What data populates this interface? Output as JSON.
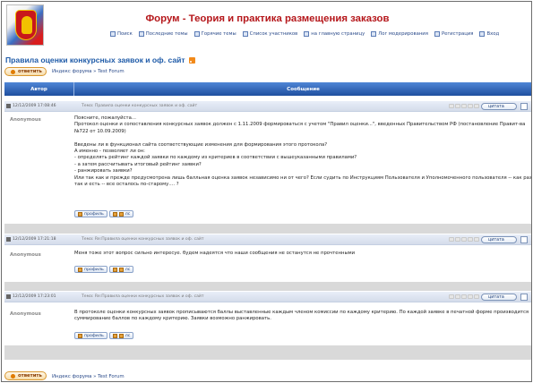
{
  "header": {
    "title": "Форум - Теория и практика размещения заказов",
    "nav": [
      {
        "label": "Поиск",
        "icon": "search-icon"
      },
      {
        "label": "Последние темы",
        "icon": "topics-icon"
      },
      {
        "label": "Горячие темы",
        "icon": "hot-topics-icon"
      },
      {
        "label": "Список участников",
        "icon": "members-icon"
      },
      {
        "label": "на главную страницу",
        "icon": "home-icon"
      },
      {
        "label": "Лог модерирования",
        "icon": "moderation-log-icon"
      },
      {
        "label": "Регистрация",
        "icon": "register-icon"
      },
      {
        "label": "Вход",
        "icon": "login-icon"
      }
    ]
  },
  "topic": {
    "title": "Правила оценки конкурсных заявок и оф. сайт"
  },
  "toolbar": {
    "reply_label": "ответить",
    "breadcrumb": "Индекс форума » Test Forum"
  },
  "table": {
    "col_author": "Автор",
    "col_message": "Сообщение"
  },
  "posts": [
    {
      "date": "12/12/2009 17:08:46",
      "subject": "Тема: Правила оценки конкурсных заявок и оф. сайт",
      "author": "Anonymous",
      "quote_label": "цитата",
      "lines": [
        "Поясните, пожалуйста...",
        "Протокол оценки и сопоставления конкурсных заявок должен с 1.11.2009 формироваться с учетом \"Правил оценки...\", введенных Правительством РФ (постановление Правит-ва",
        "№722 от 10.09.2009)",
        "",
        "Введены ли в функционал сайта соответствующие изменения для формирования этого протокола?",
        "А именно - позволяет ли он:",
        "- определять рейтинг каждой заявки по каждому из критериев в соответствии с вышеуказанными правилами?",
        "- а затем рассчитывать итоговый рейтинг заявки?",
        "- ранжировать заявки?",
        "Или так как и прежде предусмотрена лишь балльная оценка заявок независимо ни от чего? Если судить по Инструкциям Пользователя и Уполномоченного пользователя -- как раз",
        "так и есть -- все осталось по-старому.... ?"
      ],
      "profile_label": "профиль",
      "pm_label": "лс"
    },
    {
      "date": "12/12/2009 17:21:18",
      "subject": "Тема: Re:Правила оценки конкурсных заявок и оф. сайт",
      "author": "Anonymous",
      "quote_label": "цитата",
      "lines": [
        "Меня тоже этот вопрос сильно интересуе. будем надеятся что наши сообщения не останутся не прочтенными"
      ],
      "profile_label": "профиль",
      "pm_label": "лс"
    },
    {
      "date": "12/12/2009 17:23:01",
      "subject": "Тема: Re:Правила оценки конкурсных заявок и оф. сайт",
      "author": "Anonymous",
      "quote_label": "цитата",
      "lines": [
        "В протоколе оценки конкурсных заявок прописываются баллы выставленные каждым членом комиссии по каждому критерию. По каждой заявке в печатной форме производится",
        "суммирование баллов по каждому критерию. Заявки возможно ранжировать."
      ],
      "profile_label": "профиль",
      "pm_label": "лс"
    }
  ],
  "footer": {
    "reply_label": "ответить",
    "breadcrumb": "Индекс форума » Test Forum"
  }
}
